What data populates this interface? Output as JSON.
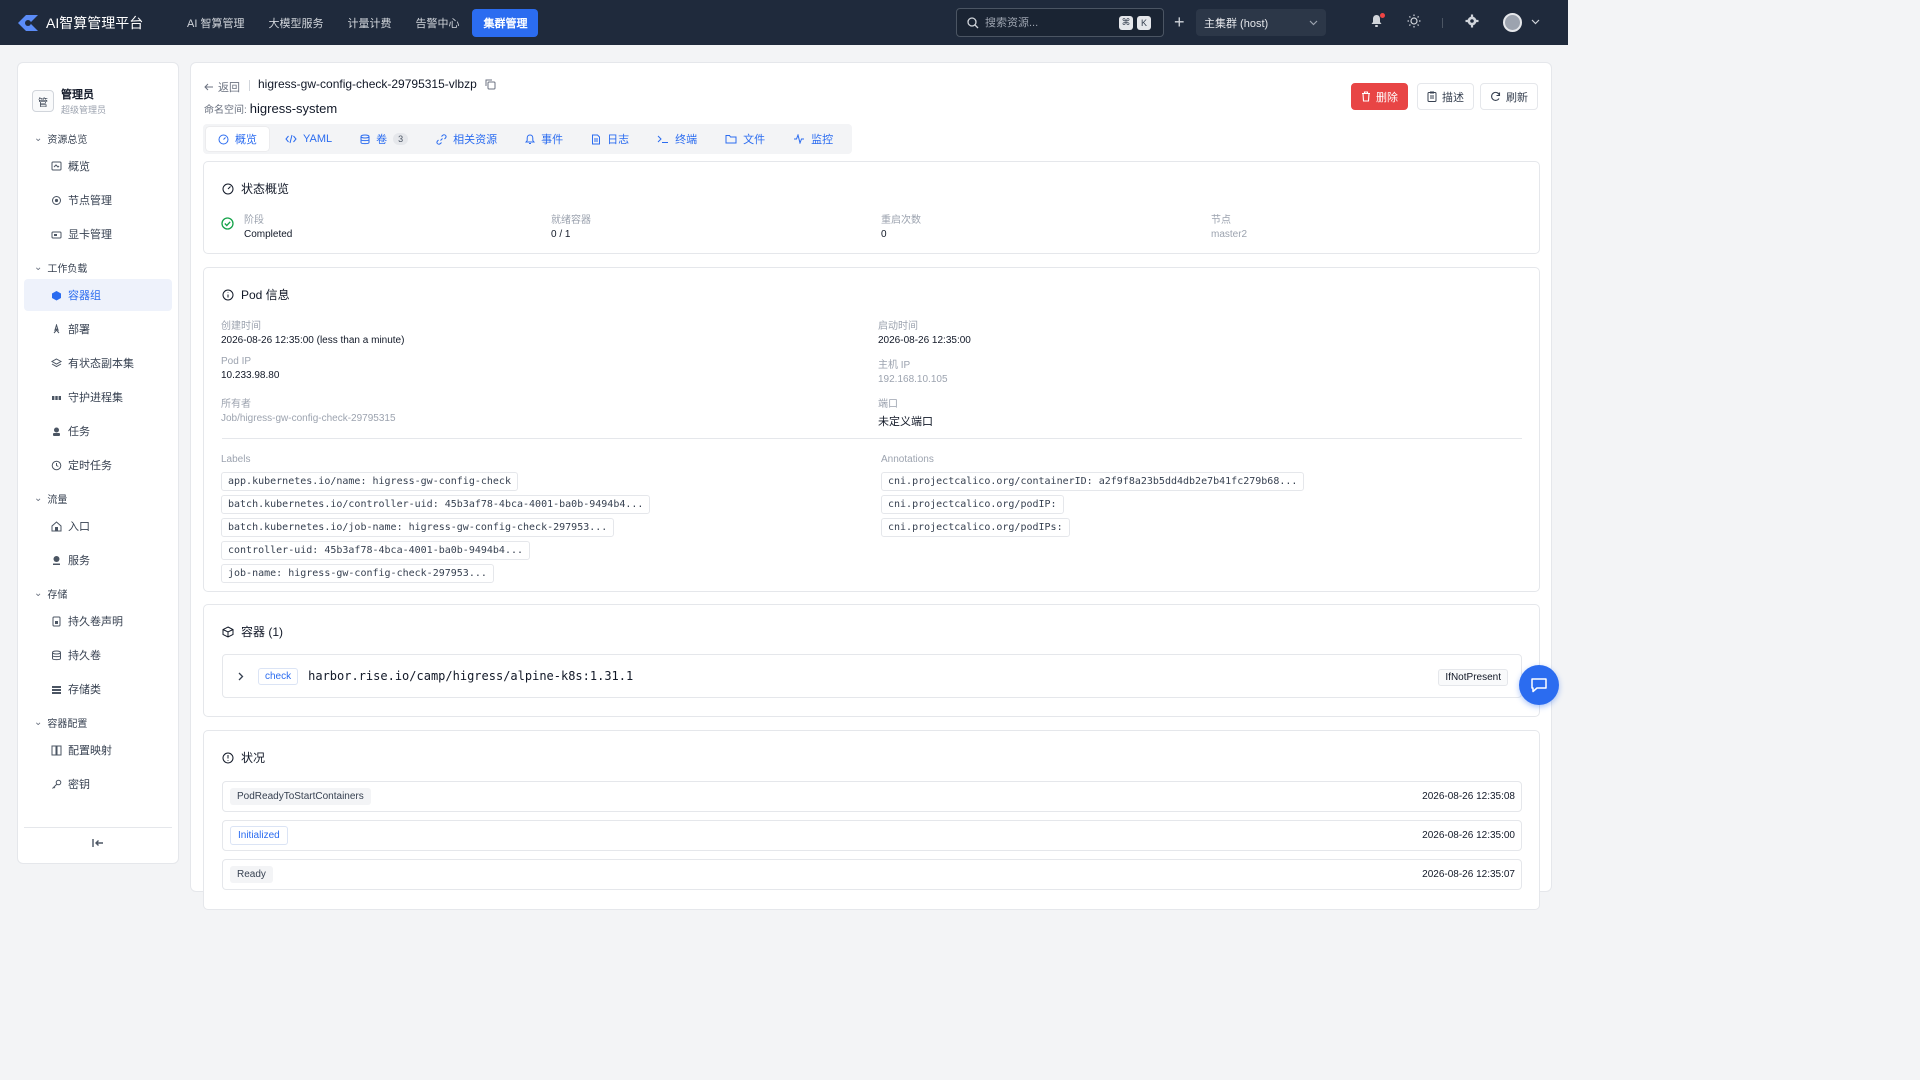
{
  "topbar": {
    "brand": "AI智算管理平台",
    "nav": [
      "AI 智算管理",
      "大模型服务",
      "计量计费",
      "告警中心",
      "集群管理"
    ],
    "search_placeholder": "搜索资源...",
    "kbd1": "⌘",
    "kbd2": "K",
    "cluster": "主集群 (host)"
  },
  "sidebar": {
    "user_name": "管理员",
    "user_role": "超级管理员",
    "user_avatar": "管",
    "groups": [
      {
        "title": "资源总览",
        "items": [
          "概览",
          "节点管理",
          "显卡管理"
        ]
      },
      {
        "title": "工作负载",
        "items": [
          "容器组",
          "部署",
          "有状态副本集",
          "守护进程集",
          "任务",
          "定时任务"
        ]
      },
      {
        "title": "流量",
        "items": [
          "入口",
          "服务"
        ]
      },
      {
        "title": "存储",
        "items": [
          "持久卷声明",
          "持久卷",
          "存储类"
        ]
      },
      {
        "title": "容器配置",
        "items": [
          "配置映射",
          "密钥"
        ]
      }
    ]
  },
  "header": {
    "back": "返回",
    "pod_name": "higress-gw-config-check-29795315-vlbzp",
    "ns_label": "命名空间:",
    "namespace": "higress-system",
    "delete": "删除",
    "describe": "描述",
    "refresh": "刷新"
  },
  "tabs": [
    {
      "label": "概览"
    },
    {
      "label": "YAML"
    },
    {
      "label": "卷",
      "count": "3"
    },
    {
      "label": "相关资源"
    },
    {
      "label": "事件"
    },
    {
      "label": "日志"
    },
    {
      "label": "终端"
    },
    {
      "label": "文件"
    },
    {
      "label": "监控"
    }
  ],
  "status": {
    "title": "状态概览",
    "phase_label": "阶段",
    "phase": "Completed",
    "ready_label": "就绪容器",
    "ready": "0 / 1",
    "restart_label": "重启次数",
    "restart": "0",
    "node_label": "节点",
    "node": "master2"
  },
  "pod_info": {
    "title": "Pod 信息",
    "created_label": "创建时间",
    "created": "2026-08-26 12:35:00 (less than a minute)",
    "started_label": "启动时间",
    "started": "2026-08-26 12:35:00",
    "pod_ip_label": "Pod IP",
    "pod_ip": "10.233.98.80",
    "host_ip_label": "主机 IP",
    "host_ip": "192.168.10.105",
    "owner_label": "所有者",
    "owner": "Job/higress-gw-config-check-29795315",
    "port_label": "端口",
    "port": "未定义端口",
    "labels_title": "Labels",
    "labels": [
      "app.kubernetes.io/name: higress-gw-config-check",
      "batch.kubernetes.io/controller-uid: 45b3af78-4bca-4001-ba0b-9494b4...",
      "batch.kubernetes.io/job-name: higress-gw-config-check-297953...",
      "controller-uid: 45b3af78-4bca-4001-ba0b-9494b4...",
      "job-name: higress-gw-config-check-297953..."
    ],
    "annotations_title": "Annotations",
    "annotations": [
      "cni.projectcalico.org/containerID: a2f9f8a23b5dd4db2e7b41fc279b68...",
      "cni.projectcalico.org/podIP:",
      "cni.projectcalico.org/podIPs:"
    ]
  },
  "containers": {
    "title": "容器 (1)",
    "name": "check",
    "image": "harbor.rise.io/camp/higress/alpine-k8s:1.31.1",
    "pull_policy": "IfNotPresent"
  },
  "conditions": {
    "title": "状况",
    "rows": [
      {
        "type": "PodReadyToStartContainers",
        "time": "2026-08-26 12:35:08"
      },
      {
        "type": "Initialized",
        "time": "2026-08-26 12:35:00"
      },
      {
        "type": "Ready",
        "time": "2026-08-26 12:35:07"
      }
    ]
  }
}
